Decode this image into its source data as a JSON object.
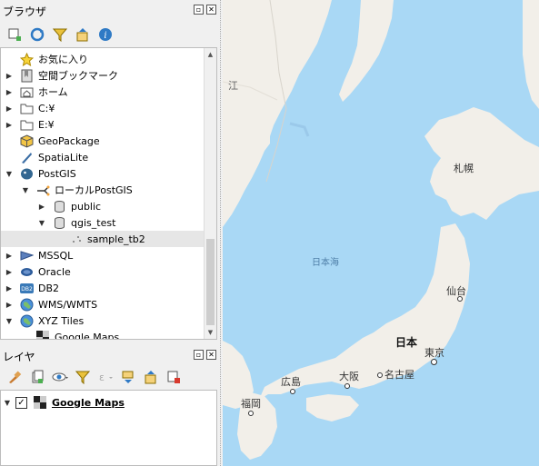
{
  "browser_panel": {
    "title": "ブラウザ",
    "items": [
      {
        "label": "お気に入り",
        "icon": "star-icon",
        "arrow": "",
        "indent": 0
      },
      {
        "label": "空間ブックマーク",
        "icon": "bookmark-icon",
        "arrow": "▶",
        "indent": 0
      },
      {
        "label": "ホーム",
        "icon": "home-folder-icon",
        "arrow": "▶",
        "indent": 0
      },
      {
        "label": "C:¥",
        "icon": "folder-icon",
        "arrow": "▶",
        "indent": 0
      },
      {
        "label": "E:¥",
        "icon": "folder-icon",
        "arrow": "▶",
        "indent": 0
      },
      {
        "label": "GeoPackage",
        "icon": "geopackage-icon",
        "arrow": "",
        "indent": 0
      },
      {
        "label": "SpatiaLite",
        "icon": "spatialite-icon",
        "arrow": "",
        "indent": 0
      },
      {
        "label": "PostGIS",
        "icon": "postgis-icon",
        "arrow": "▼",
        "indent": 0
      },
      {
        "label": "ローカルPostGIS",
        "icon": "connection-icon",
        "arrow": "▼",
        "indent": 1
      },
      {
        "label": "public",
        "icon": "schema-icon",
        "arrow": "▶",
        "indent": 2
      },
      {
        "label": "qgis_test",
        "icon": "schema-icon",
        "arrow": "▼",
        "indent": 2
      },
      {
        "label": "sample_tb2",
        "icon": "point-layer-icon",
        "arrow": "",
        "indent": 3
      },
      {
        "label": "MSSQL",
        "icon": "mssql-icon",
        "arrow": "▶",
        "indent": 0
      },
      {
        "label": "Oracle",
        "icon": "oracle-icon",
        "arrow": "▶",
        "indent": 0
      },
      {
        "label": "DB2",
        "icon": "db2-icon",
        "arrow": "▶",
        "indent": 0
      },
      {
        "label": "WMS/WMTS",
        "icon": "globe-icon",
        "arrow": "▶",
        "indent": 0
      },
      {
        "label": "XYZ Tiles",
        "icon": "globe-icon",
        "arrow": "▼",
        "indent": 0
      },
      {
        "label": "Google Maps",
        "icon": "tile-layer-icon",
        "arrow": "",
        "indent": 1
      }
    ],
    "db2_icon_text": "DB2"
  },
  "layers_panel": {
    "title": "レイヤ",
    "layers": [
      {
        "label": "Google Maps",
        "checked": true
      }
    ]
  },
  "map": {
    "labels": {
      "sea": "日本海",
      "country": "日本",
      "sapporo": "札幌",
      "sendai": "仙台",
      "tokyo": "東京",
      "nagoya": "名古屋",
      "osaka": "大阪",
      "hiroshima": "広島",
      "fukuoka": "福岡",
      "coast_fragment": "江"
    },
    "colors": {
      "sea": "#a9d8f5",
      "land": "#f2efe9",
      "accent": "#000000"
    }
  }
}
